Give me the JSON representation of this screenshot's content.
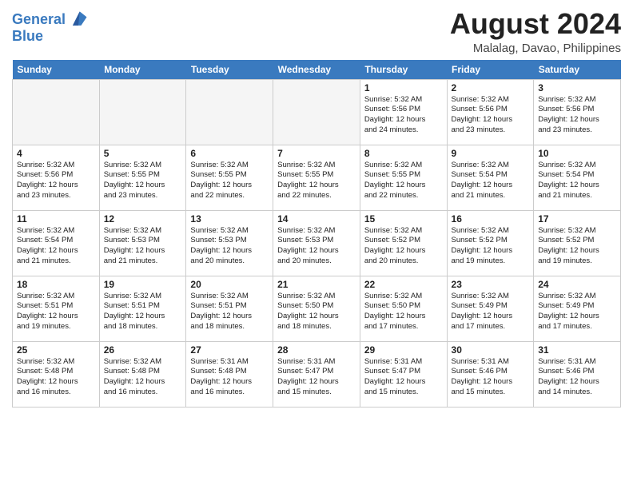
{
  "header": {
    "logo_line1": "General",
    "logo_line2": "Blue",
    "month_year": "August 2024",
    "location": "Malalag, Davao, Philippines"
  },
  "weekdays": [
    "Sunday",
    "Monday",
    "Tuesday",
    "Wednesday",
    "Thursday",
    "Friday",
    "Saturday"
  ],
  "weeks": [
    [
      {
        "day": "",
        "info": ""
      },
      {
        "day": "",
        "info": ""
      },
      {
        "day": "",
        "info": ""
      },
      {
        "day": "",
        "info": ""
      },
      {
        "day": "1",
        "info": "Sunrise: 5:32 AM\nSunset: 5:56 PM\nDaylight: 12 hours\nand 24 minutes."
      },
      {
        "day": "2",
        "info": "Sunrise: 5:32 AM\nSunset: 5:56 PM\nDaylight: 12 hours\nand 23 minutes."
      },
      {
        "day": "3",
        "info": "Sunrise: 5:32 AM\nSunset: 5:56 PM\nDaylight: 12 hours\nand 23 minutes."
      }
    ],
    [
      {
        "day": "4",
        "info": "Sunrise: 5:32 AM\nSunset: 5:56 PM\nDaylight: 12 hours\nand 23 minutes."
      },
      {
        "day": "5",
        "info": "Sunrise: 5:32 AM\nSunset: 5:55 PM\nDaylight: 12 hours\nand 23 minutes."
      },
      {
        "day": "6",
        "info": "Sunrise: 5:32 AM\nSunset: 5:55 PM\nDaylight: 12 hours\nand 22 minutes."
      },
      {
        "day": "7",
        "info": "Sunrise: 5:32 AM\nSunset: 5:55 PM\nDaylight: 12 hours\nand 22 minutes."
      },
      {
        "day": "8",
        "info": "Sunrise: 5:32 AM\nSunset: 5:55 PM\nDaylight: 12 hours\nand 22 minutes."
      },
      {
        "day": "9",
        "info": "Sunrise: 5:32 AM\nSunset: 5:54 PM\nDaylight: 12 hours\nand 21 minutes."
      },
      {
        "day": "10",
        "info": "Sunrise: 5:32 AM\nSunset: 5:54 PM\nDaylight: 12 hours\nand 21 minutes."
      }
    ],
    [
      {
        "day": "11",
        "info": "Sunrise: 5:32 AM\nSunset: 5:54 PM\nDaylight: 12 hours\nand 21 minutes."
      },
      {
        "day": "12",
        "info": "Sunrise: 5:32 AM\nSunset: 5:53 PM\nDaylight: 12 hours\nand 21 minutes."
      },
      {
        "day": "13",
        "info": "Sunrise: 5:32 AM\nSunset: 5:53 PM\nDaylight: 12 hours\nand 20 minutes."
      },
      {
        "day": "14",
        "info": "Sunrise: 5:32 AM\nSunset: 5:53 PM\nDaylight: 12 hours\nand 20 minutes."
      },
      {
        "day": "15",
        "info": "Sunrise: 5:32 AM\nSunset: 5:52 PM\nDaylight: 12 hours\nand 20 minutes."
      },
      {
        "day": "16",
        "info": "Sunrise: 5:32 AM\nSunset: 5:52 PM\nDaylight: 12 hours\nand 19 minutes."
      },
      {
        "day": "17",
        "info": "Sunrise: 5:32 AM\nSunset: 5:52 PM\nDaylight: 12 hours\nand 19 minutes."
      }
    ],
    [
      {
        "day": "18",
        "info": "Sunrise: 5:32 AM\nSunset: 5:51 PM\nDaylight: 12 hours\nand 19 minutes."
      },
      {
        "day": "19",
        "info": "Sunrise: 5:32 AM\nSunset: 5:51 PM\nDaylight: 12 hours\nand 18 minutes."
      },
      {
        "day": "20",
        "info": "Sunrise: 5:32 AM\nSunset: 5:51 PM\nDaylight: 12 hours\nand 18 minutes."
      },
      {
        "day": "21",
        "info": "Sunrise: 5:32 AM\nSunset: 5:50 PM\nDaylight: 12 hours\nand 18 minutes."
      },
      {
        "day": "22",
        "info": "Sunrise: 5:32 AM\nSunset: 5:50 PM\nDaylight: 12 hours\nand 17 minutes."
      },
      {
        "day": "23",
        "info": "Sunrise: 5:32 AM\nSunset: 5:49 PM\nDaylight: 12 hours\nand 17 minutes."
      },
      {
        "day": "24",
        "info": "Sunrise: 5:32 AM\nSunset: 5:49 PM\nDaylight: 12 hours\nand 17 minutes."
      }
    ],
    [
      {
        "day": "25",
        "info": "Sunrise: 5:32 AM\nSunset: 5:48 PM\nDaylight: 12 hours\nand 16 minutes."
      },
      {
        "day": "26",
        "info": "Sunrise: 5:32 AM\nSunset: 5:48 PM\nDaylight: 12 hours\nand 16 minutes."
      },
      {
        "day": "27",
        "info": "Sunrise: 5:31 AM\nSunset: 5:48 PM\nDaylight: 12 hours\nand 16 minutes."
      },
      {
        "day": "28",
        "info": "Sunrise: 5:31 AM\nSunset: 5:47 PM\nDaylight: 12 hours\nand 15 minutes."
      },
      {
        "day": "29",
        "info": "Sunrise: 5:31 AM\nSunset: 5:47 PM\nDaylight: 12 hours\nand 15 minutes."
      },
      {
        "day": "30",
        "info": "Sunrise: 5:31 AM\nSunset: 5:46 PM\nDaylight: 12 hours\nand 15 minutes."
      },
      {
        "day": "31",
        "info": "Sunrise: 5:31 AM\nSunset: 5:46 PM\nDaylight: 12 hours\nand 14 minutes."
      }
    ]
  ]
}
